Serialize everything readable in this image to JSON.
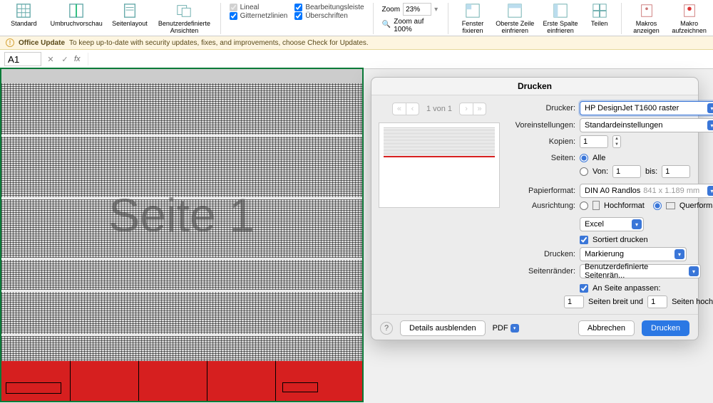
{
  "ribbon": {
    "standard": "Standard",
    "umbruch": "Umbruchvorschau",
    "seitenlayout": "Seitenlayout",
    "benutzer": "Benutzerdefinierte Ansichten",
    "lineal": "Lineal",
    "gitter": "Gitternetzlinien",
    "bearbleiste": "Bearbeitungsleiste",
    "ueberschriften": "Überschriften",
    "zoom_label": "Zoom",
    "zoom_value": "23%",
    "zoom100": "Zoom auf 100%",
    "fenster_fix": "Fenster fixieren",
    "oberste": "Oberste Zeile einfrieren",
    "erste_spalte": "Erste Spalte einfrieren",
    "teilen": "Teilen",
    "makros_anz": "Makros anzeigen",
    "makro_aufz": "Makro aufzeichnen"
  },
  "update": {
    "title": "Office Update",
    "text": "To keep up-to-date with security updates, fixes, and improvements, choose Check for Updates."
  },
  "fbar": {
    "cell": "A1",
    "fx": "fx"
  },
  "sheet": {
    "watermark": "Seite 1"
  },
  "dlg": {
    "title": "Drucken",
    "pager": "1 von 1",
    "drucker_label": "Drucker:",
    "drucker_value": "HP DesignJet T1600 raster",
    "vorein_label": "Voreinstellungen:",
    "vorein_value": "Standardeinstellungen",
    "kopien_label": "Kopien:",
    "kopien_value": "1",
    "seiten_label": "Seiten:",
    "alle": "Alle",
    "von": "Von:",
    "von_value": "1",
    "bis": "bis:",
    "bis_value": "1",
    "papier_label": "Papierformat:",
    "papier_value": "DIN A0 Randlos",
    "papier_dim": "841 x 1.189 mm",
    "ausrichtung_label": "Ausrichtung:",
    "hoch": "Hochformat",
    "quer": "Querformat",
    "app": "Excel",
    "sortiert": "Sortiert drucken",
    "drucken_sel_label": "Drucken:",
    "drucken_sel_value": "Markierung",
    "raender_label": "Seitenränder:",
    "raender_value": "Benutzerdefinierte Seitenrän...",
    "anpassen": "An Seite anpassen:",
    "breit_value": "1",
    "breit": "Seiten breit und",
    "hoch_value": "1",
    "hoch_label": "Seiten hoch",
    "details": "Details ausblenden",
    "pdf": "PDF",
    "abbrechen": "Abbrechen",
    "drucken_btn": "Drucken"
  }
}
